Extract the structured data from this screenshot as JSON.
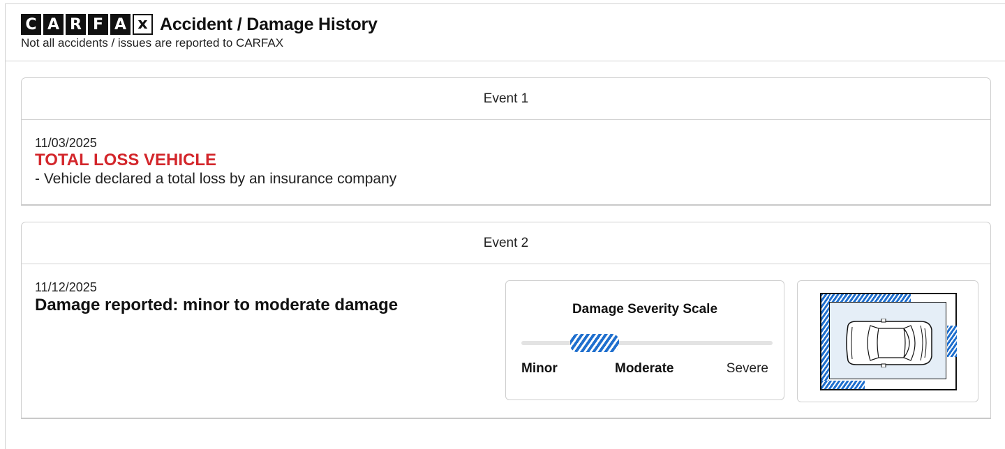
{
  "header": {
    "logo_letters": [
      "C",
      "A",
      "R",
      "F",
      "A",
      "x"
    ],
    "title": "Accident / Damage History",
    "subtitle": "Not all accidents / issues are reported to CARFAX"
  },
  "events": [
    {
      "label": "Event 1",
      "date": "11/03/2025",
      "headline": "TOTAL LOSS VEHICLE",
      "detail": "- Vehicle declared a total loss by an insurance company"
    },
    {
      "label": "Event 2",
      "date": "11/12/2025",
      "headline": "Damage reported: minor to moderate damage",
      "severity": {
        "title": "Damage Severity Scale",
        "labels": [
          "Minor",
          "Moderate",
          "Severe"
        ],
        "level": "minor-to-moderate"
      },
      "diagram": {
        "icon": "car-top-view-icon",
        "damaged_areas": [
          "front-left",
          "left-side",
          "rear-left",
          "right-side"
        ]
      }
    }
  ],
  "colors": {
    "accent_red": "#d3262b",
    "damage_blue": "#1f6fce",
    "border": "#cfcfcf"
  }
}
